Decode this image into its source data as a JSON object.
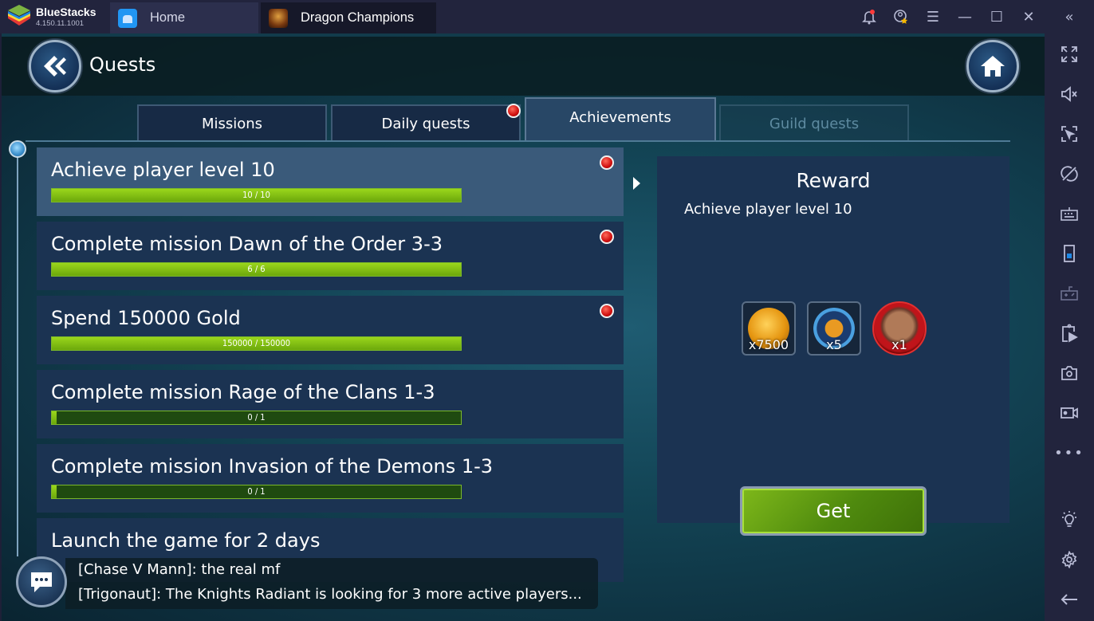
{
  "emulator": {
    "brand": "BlueStacks",
    "version": "4.150.11.1001",
    "tabs": [
      {
        "label": "Home",
        "icon": "home-icon"
      },
      {
        "label": "Dragon Champions",
        "icon": "dragon-champions-app-icon"
      }
    ],
    "title_icons": [
      "notification-bell-icon",
      "account-star-icon",
      "menu-icon",
      "minimize-icon",
      "maximize-icon",
      "close-icon",
      "collapse-sidebar-icon"
    ],
    "sidebar_icons": [
      "fullscreen-icon",
      "mute-volume-icon",
      "lock-cursor-icon",
      "hide-icon",
      "keyboard-icon",
      "portrait-mode-icon",
      "gamepad-icon",
      "media-manager-icon",
      "screenshot-icon",
      "record-video-icon",
      "more-icon",
      "tips-lightbulb-icon",
      "settings-gear-icon",
      "back-arrow-icon"
    ]
  },
  "game": {
    "header": {
      "title": "Quests"
    },
    "tabs": [
      {
        "label": "Missions",
        "state": "normal",
        "badge": false
      },
      {
        "label": "Daily quests",
        "state": "normal",
        "badge": true
      },
      {
        "label": "Achievements",
        "state": "active",
        "badge": false
      },
      {
        "label": "Guild quests",
        "state": "disabled",
        "badge": false
      }
    ],
    "quests": [
      {
        "title": "Achieve player level 10",
        "progress_text": "10 / 10",
        "progress": 1.0,
        "badge": true,
        "selected": true
      },
      {
        "title": "Complete mission Dawn of the Order 3-3",
        "progress_text": "6 / 6",
        "progress": 1.0,
        "badge": true,
        "selected": false
      },
      {
        "title": "Spend 150000 Gold",
        "progress_text": "150000 / 150000",
        "progress": 1.0,
        "badge": true,
        "selected": false
      },
      {
        "title": "Complete mission Rage of the Clans 1-3",
        "progress_text": "0 / 1",
        "progress": 0.0,
        "badge": false,
        "selected": false
      },
      {
        "title": "Complete mission Invasion of the Demons 1-3",
        "progress_text": "0 / 1",
        "progress": 0.0,
        "badge": false,
        "selected": false
      },
      {
        "title": "Launch the game for 2 days",
        "progress_text": "",
        "progress": null,
        "badge": false,
        "selected": false
      }
    ],
    "reward": {
      "title": "Reward",
      "description": "Achieve player level 10",
      "items": [
        {
          "name": "gold-coin",
          "quantity": "x7500"
        },
        {
          "name": "dragon-emblem",
          "quantity": "x5"
        },
        {
          "name": "hero-portrait",
          "quantity": "x1"
        }
      ],
      "get_label": "Get"
    },
    "chat": {
      "messages": [
        "[Chase V Mann]: the real mf",
        "[Trigonaut]: The Knights Radiant is looking for 3 more active players..."
      ]
    }
  }
}
